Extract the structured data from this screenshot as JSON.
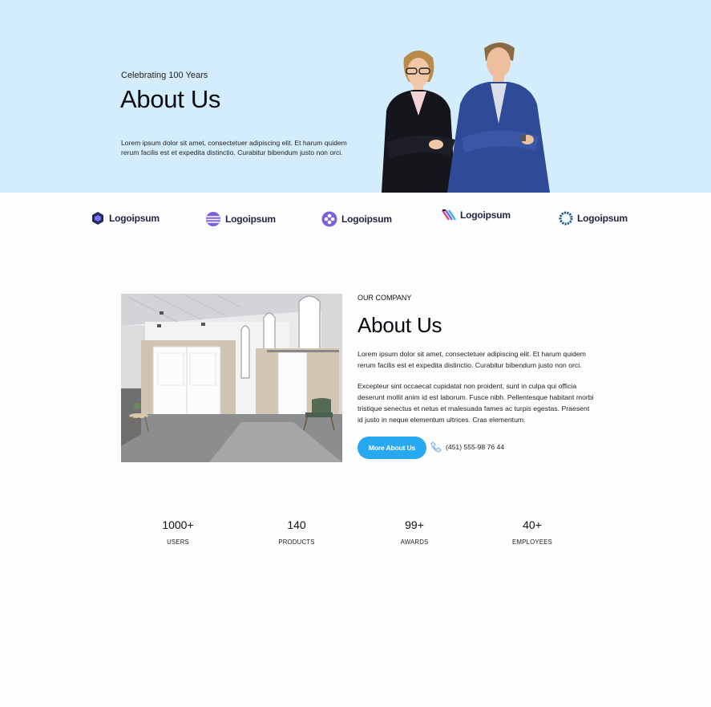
{
  "hero": {
    "subtitle": "Celebrating 100 Years",
    "title": "About Us",
    "text": "Lorem ipsum dolor sit amet, consectetuer adipiscing elit. Et harum quidem rerum facilis est et expedita distinctio. Curabitur bibendum justo non orci."
  },
  "logos": [
    {
      "label": "Logoipsum",
      "icon": "hexagon-logo-icon"
    },
    {
      "label": "Logoipsum",
      "icon": "globe-stripes-logo-icon"
    },
    {
      "label": "Logoipsum",
      "icon": "diamond-circle-logo-icon"
    },
    {
      "label": "Logoipsum",
      "icon": "stripes-logo-icon"
    },
    {
      "label": "Logoipsum",
      "icon": "ring-logo-icon"
    }
  ],
  "about": {
    "eyebrow": "OUR COMPANY",
    "title": "About Us",
    "paragraph1": "Lorem ipsum dolor sit amet, consectetuer adipiscing elit. Et harum quidem rerum facilis est et expedita distinctio. Curabitur bibendum justo non orci.",
    "paragraph2": " Excepteur sint occaecat cupidatat non proident, sunt in culpa qui officia deserunt mollit anim id est laborum. Fusce nibh. Pellentesque habitant morbi tristique senectus et netus et malesuada fames ac turpis egestas. Praesent id justo in neque elementum ultrices. Cras elementum.",
    "button_label": "More About Us",
    "phone": "(451) 555-98 76 44"
  },
  "stats": [
    {
      "value": "1000+",
      "label": "USERS"
    },
    {
      "value": "140",
      "label": "PRODUCTS"
    },
    {
      "value": "99+",
      "label": "AWARDS"
    },
    {
      "value": "40+",
      "label": "EMPLOYEES"
    }
  ],
  "colors": {
    "hero_bg": "#d4edfd",
    "accent": "#27a9f1",
    "logo_text": "#1f2340"
  }
}
